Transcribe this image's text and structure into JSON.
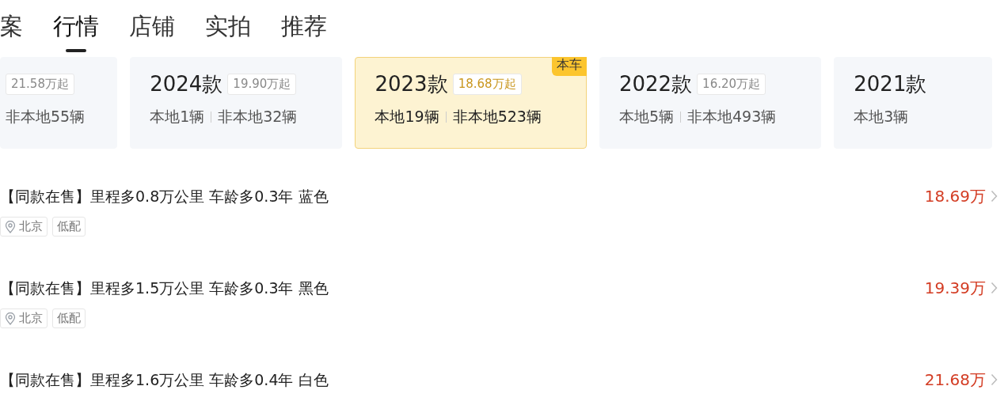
{
  "tabs": [
    {
      "label": "案",
      "selected": false
    },
    {
      "label": "行情",
      "selected": true
    },
    {
      "label": "店铺",
      "selected": false
    },
    {
      "label": "实拍",
      "selected": false
    },
    {
      "label": "推荐",
      "selected": false
    }
  ],
  "model_years": [
    {
      "price": "21.58万起",
      "nonlocal": "非本地55辆",
      "selected": false
    },
    {
      "year": "2024款",
      "price": "19.90万起",
      "local": "本地1辆",
      "nonlocal": "非本地32辆",
      "selected": false
    },
    {
      "year": "2023款",
      "price": "18.68万起",
      "local": "本地19辆",
      "nonlocal": "非本地523辆",
      "selected": true,
      "badge": "本车"
    },
    {
      "year": "2022款",
      "price": "16.20万起",
      "local": "本地5辆",
      "nonlocal": "非本地493辆",
      "selected": false
    },
    {
      "year": "2021款",
      "local": "本地3辆",
      "selected": false
    }
  ],
  "listings": [
    {
      "title": "【同款在售】里程多0.8万公里 车龄多0.3年 蓝色",
      "price": "18.69万",
      "tags": [
        {
          "kind": "location",
          "label": "北京"
        },
        {
          "kind": "plain",
          "label": "低配"
        }
      ]
    },
    {
      "title": "【同款在售】里程多1.5万公里 车龄多0.3年 黑色",
      "price": "19.39万",
      "tags": [
        {
          "kind": "location",
          "label": "北京"
        },
        {
          "kind": "plain",
          "label": "低配"
        }
      ]
    },
    {
      "title": "【同款在售】里程多1.6万公里 车龄多0.4年 白色",
      "price": "21.68万"
    }
  ]
}
